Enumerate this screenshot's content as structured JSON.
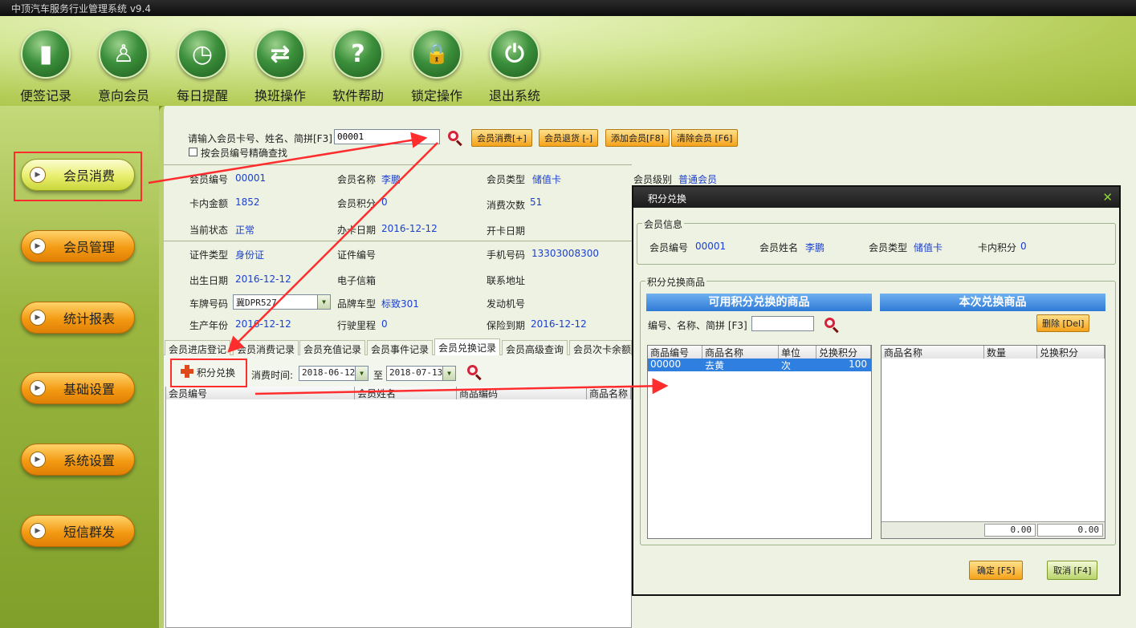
{
  "app": {
    "title": "中顶汽车服务行业管理系统 v9.4"
  },
  "toolbar": {
    "items": [
      {
        "label": "便签记录",
        "icon": "note-icon",
        "glyph": "▮"
      },
      {
        "label": "意向会员",
        "icon": "person-icon",
        "glyph": "♙"
      },
      {
        "label": "每日提醒",
        "icon": "alarm-clock-icon",
        "glyph": "◷"
      },
      {
        "label": "换班操作",
        "icon": "switch-arrows-icon",
        "glyph": "⇄"
      },
      {
        "label": "软件帮助",
        "icon": "help-icon",
        "glyph": "?"
      },
      {
        "label": "锁定操作",
        "icon": "lock-icon",
        "glyph": "🔒"
      },
      {
        "label": "退出系统",
        "icon": "power-icon",
        "glyph": "⏻"
      }
    ]
  },
  "sidebar": {
    "items": [
      {
        "label": "会员消费",
        "active": true
      },
      {
        "label": "会员管理"
      },
      {
        "label": "统计报表"
      },
      {
        "label": "基础设置"
      },
      {
        "label": "系统设置"
      },
      {
        "label": "短信群发"
      }
    ]
  },
  "search": {
    "prompt": "请输入会员卡号、姓名、简拼[F3]",
    "value": "00001",
    "exact_label": "按会员编号精确查找",
    "buttons": [
      "会员消费[+]",
      "会员退货 [-]",
      "添加会员[F8]",
      "清除会员 [F6]"
    ]
  },
  "member": {
    "id_label": "会员编号",
    "id": "00001",
    "name_label": "会员名称",
    "name": "李鹏",
    "type_label": "会员类型",
    "type": "储值卡",
    "level_label": "会员级别",
    "level": "普通会员",
    "balance_label": "卡内金额",
    "balance": "1852",
    "points_label": "会员积分",
    "points": "0",
    "count_label": "消费次数",
    "count": "51",
    "status_label": "当前状态",
    "status": "正常",
    "issue_label": "办卡日期",
    "issue": "2016-12-12",
    "open_label": "开卡日期",
    "open": "",
    "idtype_label": "证件类型",
    "idtype": "身份证",
    "idno_label": "证件编号",
    "idno": "",
    "phone_label": "手机号码",
    "phone": "13303008300",
    "birth_label": "出生日期",
    "birth": "2016-12-12",
    "email_label": "电子信箱",
    "email": "",
    "address_label": "联系地址",
    "address": "",
    "plate_label": "车牌号码",
    "plate": "冀DPR527",
    "model_label": "品牌车型",
    "model": "标致301",
    "engine_label": "发动机号",
    "engine": "",
    "year_label": "生产年份",
    "year": "2016-12-12",
    "mileage_label": "行驶里程",
    "mileage": "0",
    "insurance_label": "保险到期",
    "insurance": "2016-12-12"
  },
  "tabs": [
    "会员进店登记",
    "会员消费记录",
    "会员充值记录",
    "会员事件记录",
    "会员兑换记录",
    "会员高级查询",
    "会员次卡余额"
  ],
  "records": {
    "exchange_button": "积分兑换",
    "time_label": "消费时间:",
    "from": "2018-06-12",
    "to_label": "至",
    "to": "2018-07-13",
    "columns": [
      "会员编号",
      "会员姓名",
      "商品编码",
      "商品名称"
    ]
  },
  "dialog": {
    "title": "积分兑换",
    "member_group": "会员信息",
    "id_label": "会员编号",
    "id": "00001",
    "name_label": "会员姓名",
    "name": "李鹏",
    "type_label": "会员类型",
    "type": "储值卡",
    "points_label": "卡内积分",
    "points": "0",
    "goods_group": "积分兑换商品",
    "available_header": "可用积分兑换的商品",
    "current_header": "本次兑换商品",
    "search_label": "编号、名称、简拼 [F3]",
    "delete_button": "删除 [Del]",
    "left_columns": [
      "商品编号",
      "商品名称",
      "单位",
      "兑换积分"
    ],
    "left_rows": [
      {
        "code": "00000",
        "name": "去黄",
        "unit": "次",
        "points": "100"
      }
    ],
    "right_columns": [
      "商品名称",
      "数量",
      "兑换积分"
    ],
    "total_qty": "0.00",
    "total_points": "0.00",
    "ok_button": "确定 [F5]",
    "cancel_button": "取消 [F4]"
  },
  "colors": {
    "accent_red": "#ff2d2d",
    "link_blue": "#1a3fd0",
    "selection_blue": "#2f7fe0"
  }
}
